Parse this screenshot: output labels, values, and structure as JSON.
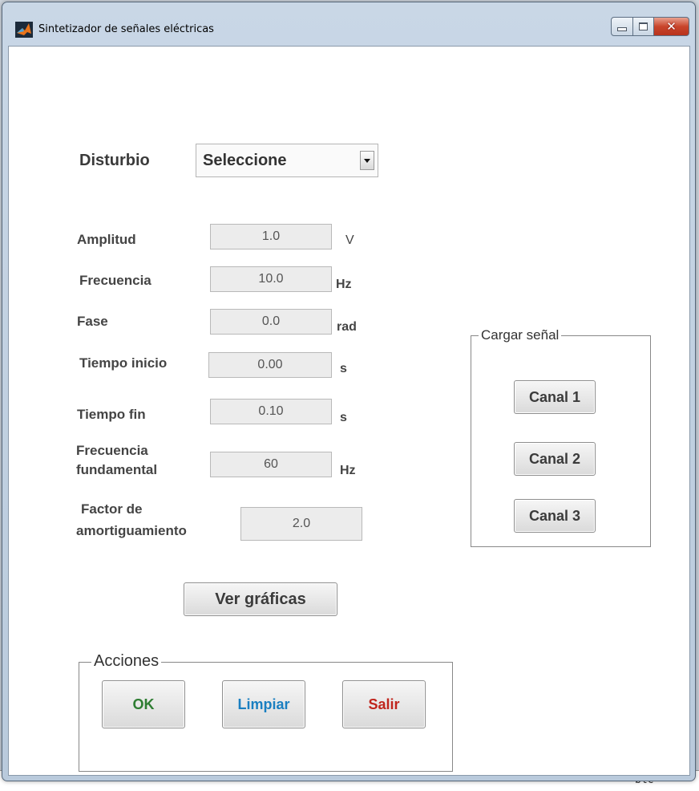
{
  "window": {
    "title": "Sintetizador de señales eléctricas"
  },
  "disturbio": {
    "label": "Disturbio",
    "selected": "Seleccione"
  },
  "params": {
    "amplitud": {
      "label": "Amplitud",
      "value": "1.0",
      "unit": "V"
    },
    "frecuencia": {
      "label": "Frecuencia",
      "value": "10.0",
      "unit": "Hz"
    },
    "fase": {
      "label": "Fase",
      "value": "0.0",
      "unit": "rad"
    },
    "t_inicio": {
      "label": "Tiempo inicio",
      "value": "0.00",
      "unit": "s"
    },
    "t_fin": {
      "label": "Tiempo fin",
      "value": "0.10",
      "unit": "s"
    },
    "f_fund": {
      "label_line1": "Frecuencia",
      "label_line2": "fundamental",
      "value": "60",
      "unit": "Hz"
    },
    "amort": {
      "label_line1": "Factor de",
      "label_line2": "amortiguamiento",
      "value": "2.0"
    }
  },
  "ver_graficas": "Ver gráficas",
  "cargar": {
    "title": "Cargar señal",
    "canal1": "Canal 1",
    "canal2": "Canal 2",
    "canal3": "Canal 3"
  },
  "acciones": {
    "title": "Acciones",
    "ok": "OK",
    "limpiar": "Limpiar",
    "salir": "Salir"
  },
  "colors": {
    "ok": "#2e7d32",
    "limpiar": "#1a7fc1",
    "salir": "#c0241c"
  },
  "background": {
    "code_snippet": "blc"
  }
}
